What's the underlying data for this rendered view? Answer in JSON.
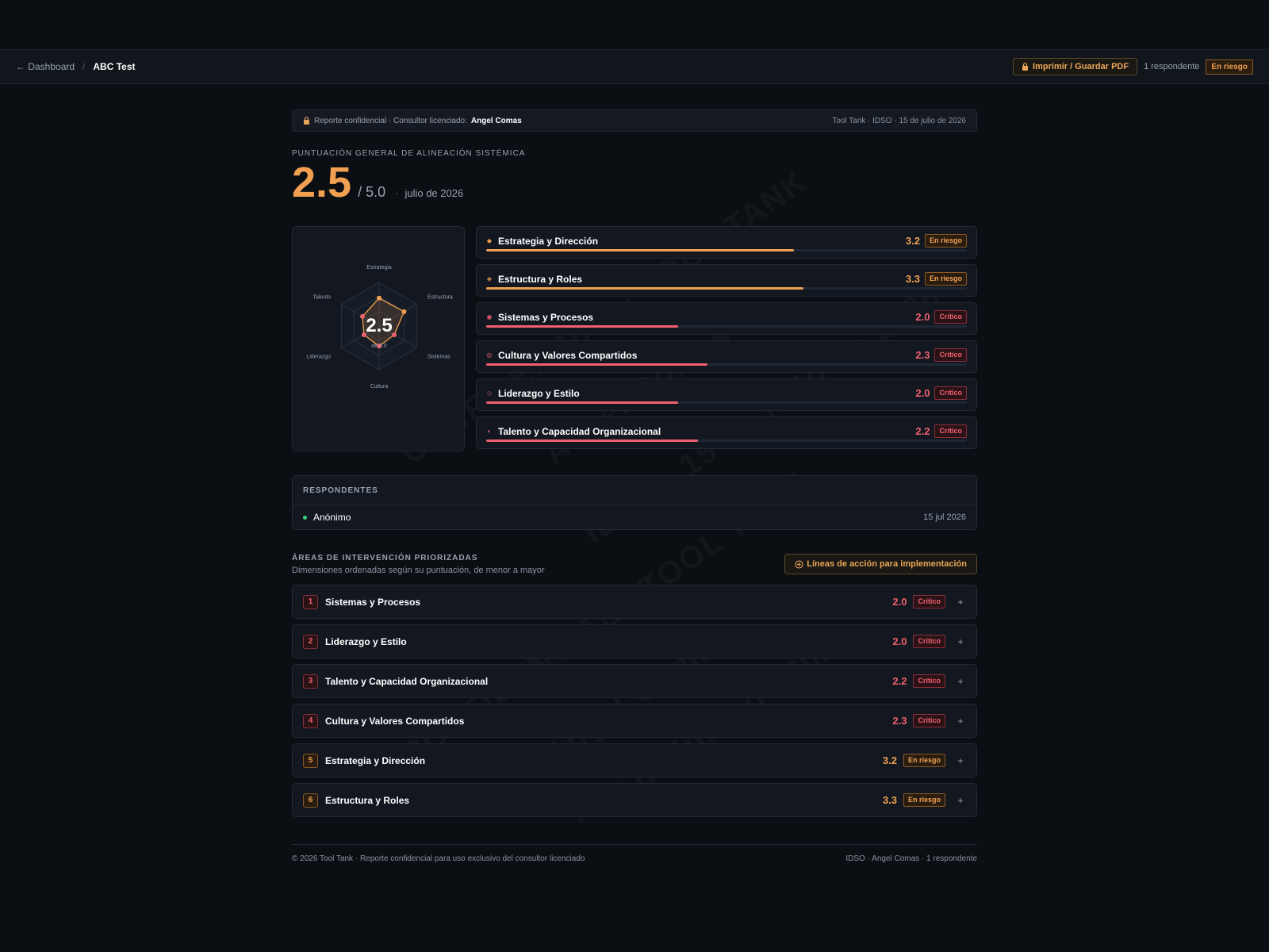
{
  "topbar": {
    "back_label": "← Dashboard",
    "separator": "/",
    "current": "ABC Test",
    "print_label": "Imprimir / Guardar PDF",
    "respondents": "1 respondente",
    "status": "En riesgo"
  },
  "confidential": {
    "prefix": "Reporte confidencial · Consultor licenciado:",
    "consultant": "Angel Comas",
    "meta": "Tool Tank · IDSO · 15 de julio de 2026"
  },
  "score": {
    "label": "PUNTUACIÓN GENERAL DE ALINEACIÓN SISTÉMICA",
    "value": "2.5",
    "max": "/ 5.0",
    "dot": "·",
    "date": "julio de 2026"
  },
  "radar": {
    "center_value": "2.5",
    "center_sub": "de 5.0",
    "max": 5,
    "axes": [
      "Estrategia",
      "Estructura",
      "Sistemas",
      "Cultura",
      "Liderazgo",
      "Talento"
    ],
    "values": [
      3.2,
      3.3,
      2.0,
      2.3,
      2.0,
      2.2
    ]
  },
  "dimensions": [
    {
      "name": "Estrategia y Dirección",
      "score": "3.2",
      "value": 3.2,
      "status": "En riesgo",
      "level": "orange",
      "icon": "◆"
    },
    {
      "name": "Estructura y Roles",
      "score": "3.3",
      "value": 3.3,
      "status": "En riesgo",
      "level": "orange",
      "icon": "◈"
    },
    {
      "name": "Sistemas y Procesos",
      "score": "2.0",
      "value": 2.0,
      "status": "Crítico",
      "level": "red",
      "icon": "◉"
    },
    {
      "name": "Cultura y Valores Compartidos",
      "score": "2.3",
      "value": 2.3,
      "status": "Crítico",
      "level": "red",
      "icon": "◎"
    },
    {
      "name": "Liderazgo y Estilo",
      "score": "2.0",
      "value": 2.0,
      "status": "Crítico",
      "level": "red",
      "icon": "◇"
    },
    {
      "name": "Talento y Capacidad Organizacional",
      "score": "2.2",
      "value": 2.2,
      "status": "Crítico",
      "level": "red",
      "icon": "◐"
    }
  ],
  "respondents_section": {
    "title": "RESPONDENTES",
    "items": [
      {
        "name": "Anónimo",
        "date": "15 jul 2026"
      }
    ]
  },
  "areas": {
    "title": "ÁREAS DE INTERVENCIÓN PRIORIZADAS",
    "subtitle": "Dimensiones ordenadas según su puntuación, de menor a mayor",
    "action_label": "Líneas de acción para implementación",
    "items": [
      {
        "rank": "1",
        "name": "Sistemas y Procesos",
        "score": "2.0",
        "status": "Crítico",
        "level": "red"
      },
      {
        "rank": "2",
        "name": "Liderazgo y Estilo",
        "score": "2.0",
        "status": "Crítico",
        "level": "red"
      },
      {
        "rank": "3",
        "name": "Talento y Capacidad Organizacional",
        "score": "2.2",
        "status": "Crítico",
        "level": "red"
      },
      {
        "rank": "4",
        "name": "Cultura y Valores Compartidos",
        "score": "2.3",
        "status": "Crítico",
        "level": "red"
      },
      {
        "rank": "5",
        "name": "Estrategia y Dirección",
        "score": "3.2",
        "status": "En riesgo",
        "level": "orange"
      },
      {
        "rank": "6",
        "name": "Estructura y Roles",
        "score": "3.3",
        "status": "En riesgo",
        "level": "orange"
      }
    ]
  },
  "footer": {
    "left": "© 2026 Tool Tank · Reporte confidencial para uso exclusivo del consultor licenciado",
    "right": "IDSO · Angel Comas · 1 respondente"
  },
  "watermark": [
    "CONFIDENCIAL · TOOL TANK",
    "Angel Comas",
    "IDSO · 15 de julio de 2026"
  ],
  "colors": {
    "orange": "#f0a050",
    "red": "#f06070",
    "green": "#3ecf7a",
    "background": "#0b0e13"
  }
}
